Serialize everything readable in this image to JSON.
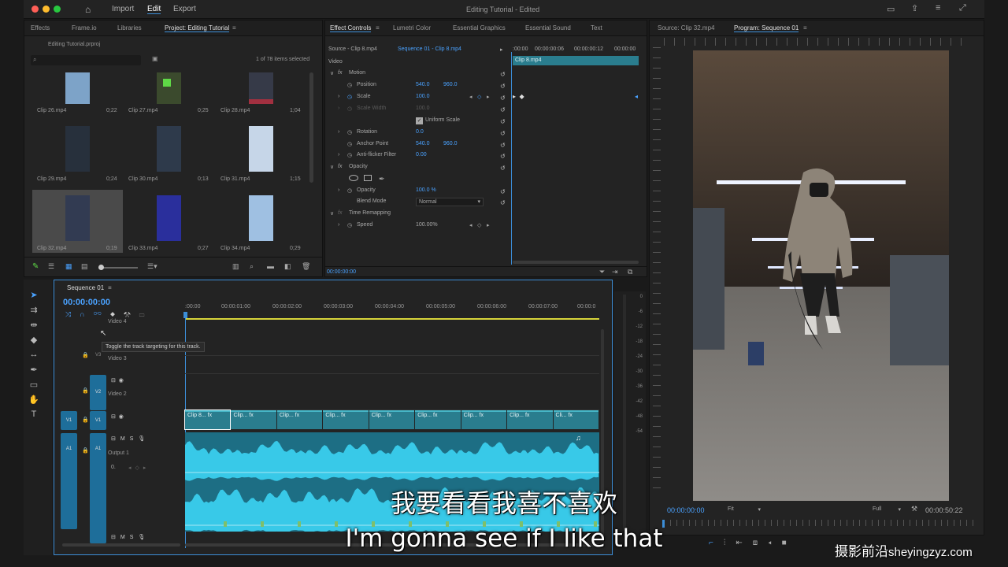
{
  "window": {
    "title": "Editing Tutorial",
    "status": "- Edited"
  },
  "menu": {
    "import": "Import",
    "edit": "Edit",
    "export": "Export"
  },
  "project_panel": {
    "tabs": [
      "Effects",
      "Frame.io",
      "Libraries",
      "Project: Editing Tutorial"
    ],
    "file": "Editing Tutorial.prproj",
    "items_count": "1 of 78 items selected",
    "clips": [
      {
        "name": "Clip 26.mp4",
        "duration": "0;22"
      },
      {
        "name": "Clip 27.mp4",
        "duration": "0;25"
      },
      {
        "name": "Clip 28.mp4",
        "duration": "1;04"
      },
      {
        "name": "Clip 29.mp4",
        "duration": "0;24"
      },
      {
        "name": "Clip 30.mp4",
        "duration": "0;13"
      },
      {
        "name": "Clip 31.mp4",
        "duration": "1;15"
      },
      {
        "name": "Clip 32.mp4",
        "duration": "0;19"
      },
      {
        "name": "Clip 33.mp4",
        "duration": "0;27"
      },
      {
        "name": "Clip 34.mp4",
        "duration": "0;29"
      }
    ]
  },
  "effect_controls": {
    "tabs": [
      "Effect Controls",
      "Lumetri Color",
      "Essential Graphics",
      "Essential Sound",
      "Text"
    ],
    "source": "Source - Clip 8.mp4",
    "sequence_clip": "Sequence 01 - Clip 8.mp4",
    "timecodes": [
      ":00:00",
      "00:00:00:06",
      "00:00:00:12",
      "00:00:00"
    ],
    "clip_label": "Clip 8.mp4",
    "video": "Video",
    "motion": "Motion",
    "position_label": "Position",
    "position_x": "540.0",
    "position_y": "960.0",
    "scale_label": "Scale",
    "scale": "100.0",
    "scale_width_label": "Scale Width",
    "scale_width": "100.0",
    "uniform_scale": "Uniform Scale",
    "rotation_label": "Rotation",
    "rotation": "0.0",
    "anchor_label": "Anchor Point",
    "anchor_x": "540.0",
    "anchor_y": "960.0",
    "antiflicker_label": "Anti-flicker Filter",
    "antiflicker": "0.00",
    "opacity_section": "Opacity",
    "opacity_label": "Opacity",
    "opacity": "100.0 %",
    "blend_label": "Blend Mode",
    "blend": "Normal",
    "time_remap": "Time Remapping",
    "speed_label": "Speed",
    "speed": "100.00%",
    "bottom_time": "00:00:00:00"
  },
  "program_monitor": {
    "tabs": [
      "Source: Clip 32.mp4",
      "Program: Sequence 01"
    ],
    "timecode": "00:00:00:00",
    "fit": "Fit",
    "quality": "Full",
    "duration": "00:00:50:22"
  },
  "timeline": {
    "tab": "Sequence 01",
    "timecode": "00:00:00:00",
    "ruler": [
      ":00:00",
      "00:00:01:00",
      "00:00:02:00",
      "00:00:03:00",
      "00:00:04:00",
      "00:00:05:00",
      "00:00:06:00",
      "00:00:07:00",
      "00:00:0"
    ],
    "tooltip": "Toggle the track targeting for this track.",
    "tracks": {
      "v4": "Video 4",
      "v3": "Video 3",
      "v2": "Video 2",
      "a1": "Output 1"
    },
    "track_ids": {
      "v3": "V3",
      "v2": "V2",
      "v1": "V1",
      "a1": "A1"
    },
    "clips": [
      "Clip 8...",
      "Clip...",
      "Clip...",
      "Clip...",
      "Clip...",
      "Clip...",
      "Clip...",
      "Clip...",
      "Cli..."
    ],
    "audio_value": "0.",
    "meter_ticks": [
      "0",
      "-6",
      "-12",
      "-18",
      "-24",
      "-30",
      "-36",
      "-42",
      "-48",
      "-54"
    ]
  },
  "subtitles": {
    "zh": "我要看看我喜不喜欢",
    "en": "I'm gonna see if I like that"
  },
  "watermark": {
    "zh": "摄影前沿",
    "url": "sheyingzyz.com"
  },
  "colors": {
    "accent": "#3c8ed8",
    "track_blue": "#1e6e9a",
    "waveform": "#38c9e8",
    "clip": "#2a7d8e"
  }
}
